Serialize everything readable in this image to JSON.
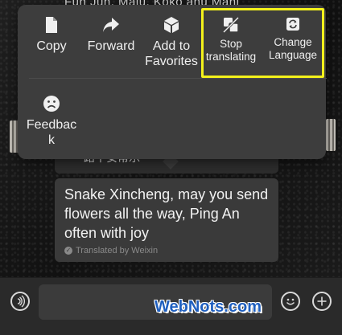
{
  "background_text": "Fun Jun, Maju, Koko anu Mani",
  "menu": {
    "items": [
      {
        "label": "Copy",
        "icon": "document-icon"
      },
      {
        "label": "Forward",
        "icon": "forward-arrow-icon"
      },
      {
        "label": "Add to Favorites",
        "icon": "cube-icon"
      },
      {
        "label": "Stop translating",
        "icon": "translate-off-icon"
      },
      {
        "label": "Change Language",
        "icon": "refresh-icon"
      },
      {
        "label": "Feedback",
        "icon": "sad-face-icon"
      }
    ],
    "highlight_color": "#f3f11b"
  },
  "messages": {
    "original_text": "一路平安常乐",
    "translated_text": "Snake Xincheng, may you send flowers all the way, Ping An often with joy",
    "translated_by": "Translated by Weixin"
  },
  "input_bar": {
    "input_value": "",
    "voice_icon": "voice-icon",
    "emoji_icon": "emoji-icon",
    "plus_icon": "plus-icon"
  },
  "watermark": "WebNots.com"
}
